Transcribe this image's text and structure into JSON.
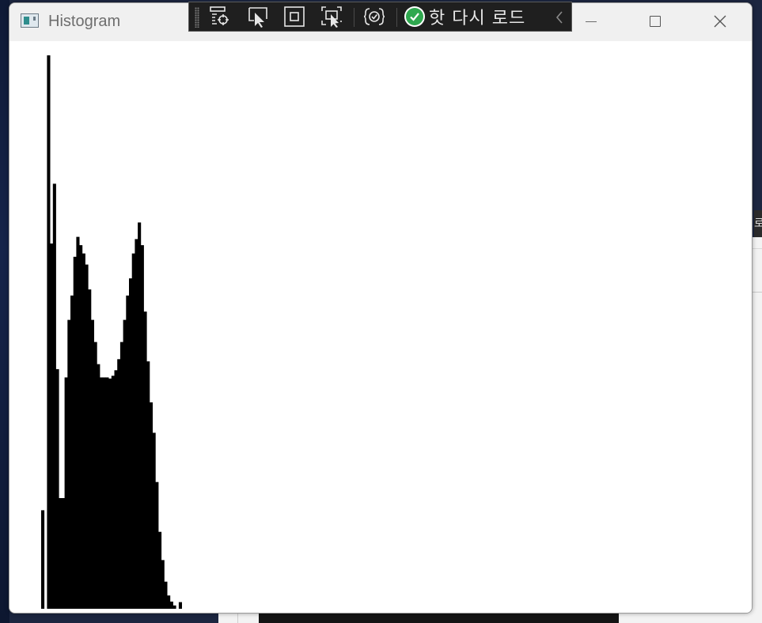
{
  "window": {
    "title": "Histogram",
    "controls": {
      "minimize": "minimize",
      "maximize": "maximize",
      "close": "close"
    }
  },
  "debug_toolbar": {
    "buttons": [
      {
        "icon": "live-visual-tree-icon"
      },
      {
        "icon": "select-element-icon"
      },
      {
        "icon": "display-layout-adorners-icon"
      },
      {
        "icon": "track-focused-element-icon"
      },
      {
        "icon": "xaml-binding-failures-icon"
      }
    ],
    "hot_reload_label": "핫 다시 로드",
    "hot_reload_status_color": "#2fa84f"
  },
  "background_tab_glyph": "로",
  "chart_data": {
    "type": "bar",
    "description_levels": "pixel intensity 0-255",
    "y_scale": "normalized to max bin",
    "color": "#000000",
    "values": [
      0,
      0,
      0,
      0,
      0,
      0,
      0,
      0,
      0,
      0,
      0,
      0,
      0,
      0,
      0,
      0,
      0,
      0,
      0,
      0,
      0,
      0,
      0,
      0,
      0,
      0,
      0,
      0,
      0,
      0,
      0,
      0,
      0,
      0,
      0,
      0,
      0,
      0,
      0,
      0,
      0,
      0,
      0,
      0,
      0,
      0,
      0,
      0,
      0,
      0,
      0,
      0,
      0,
      0,
      0,
      0,
      0,
      0,
      0,
      0,
      0,
      0,
      0,
      0,
      0,
      0,
      0,
      0,
      0,
      0,
      0,
      0,
      0,
      0,
      0,
      0,
      0,
      0,
      0,
      0,
      0,
      0,
      0,
      0,
      0,
      0,
      0,
      0,
      0,
      0,
      0,
      0,
      0,
      0,
      0,
      0,
      0,
      0,
      0,
      0,
      0,
      0,
      0,
      0,
      0,
      0,
      0,
      0,
      0,
      0,
      0,
      0,
      0,
      0,
      0,
      0,
      0,
      0,
      0,
      0,
      0,
      0,
      0,
      0,
      0,
      0,
      0,
      0,
      0,
      0,
      0,
      0,
      0,
      0,
      0,
      0,
      0,
      0,
      0,
      0,
      0,
      0,
      0,
      0,
      0,
      0,
      0,
      0,
      0,
      0,
      0,
      0,
      0,
      0,
      0,
      0,
      0,
      0,
      0,
      0,
      0,
      0,
      0,
      0,
      0,
      0,
      0,
      0,
      0,
      0,
      0,
      0,
      0,
      0,
      0,
      0,
      0,
      0,
      0,
      0,
      0,
      0,
      0,
      0,
      0,
      0,
      0,
      0,
      0,
      0,
      0,
      0,
      0,
      0,
      0,
      0,
      0,
      0,
      0,
      0,
      0,
      0,
      0,
      0,
      0,
      0,
      0,
      0,
      0,
      0,
      0,
      0,
      0,
      0,
      0,
      0,
      0,
      0,
      0,
      0,
      0,
      0,
      0,
      0,
      0,
      0,
      0,
      0,
      0,
      0,
      0,
      0,
      0,
      0,
      0,
      0,
      0,
      0,
      0,
      0,
      0,
      0,
      0,
      0,
      0,
      0,
      0,
      0,
      0,
      0,
      0,
      0,
      0,
      0,
      0,
      0,
      0,
      0,
      0,
      0,
      0
    ],
    "bins": [
      {
        "x": 0,
        "y": 0.178
      },
      {
        "x": 1,
        "y": 0
      },
      {
        "x": 2,
        "y": 1.0
      },
      {
        "x": 3,
        "y": 0.66
      },
      {
        "x": 4,
        "y": 0.768
      },
      {
        "x": 5,
        "y": 0.433
      },
      {
        "x": 6,
        "y": 0.2
      },
      {
        "x": 7,
        "y": 0.2
      },
      {
        "x": 8,
        "y": 0.418
      },
      {
        "x": 9,
        "y": 0.522
      },
      {
        "x": 10,
        "y": 0.566
      },
      {
        "x": 11,
        "y": 0.636
      },
      {
        "x": 12,
        "y": 0.672
      },
      {
        "x": 13,
        "y": 0.657
      },
      {
        "x": 14,
        "y": 0.642
      },
      {
        "x": 15,
        "y": 0.622
      },
      {
        "x": 16,
        "y": 0.577
      },
      {
        "x": 17,
        "y": 0.522
      },
      {
        "x": 18,
        "y": 0.482
      },
      {
        "x": 19,
        "y": 0.442
      },
      {
        "x": 20,
        "y": 0.418
      },
      {
        "x": 21,
        "y": 0.418
      },
      {
        "x": 22,
        "y": 0.418
      },
      {
        "x": 23,
        "y": 0.416
      },
      {
        "x": 24,
        "y": 0.421
      },
      {
        "x": 25,
        "y": 0.431
      },
      {
        "x": 26,
        "y": 0.451
      },
      {
        "x": 27,
        "y": 0.482
      },
      {
        "x": 28,
        "y": 0.522
      },
      {
        "x": 29,
        "y": 0.566
      },
      {
        "x": 30,
        "y": 0.597
      },
      {
        "x": 31,
        "y": 0.642
      },
      {
        "x": 32,
        "y": 0.668
      },
      {
        "x": 33,
        "y": 0.698
      },
      {
        "x": 34,
        "y": 0.657
      },
      {
        "x": 35,
        "y": 0.537
      },
      {
        "x": 36,
        "y": 0.447
      },
      {
        "x": 37,
        "y": 0.373
      },
      {
        "x": 38,
        "y": 0.318
      },
      {
        "x": 39,
        "y": 0.229
      },
      {
        "x": 40,
        "y": 0.139
      },
      {
        "x": 41,
        "y": 0.088
      },
      {
        "x": 42,
        "y": 0.049
      },
      {
        "x": 43,
        "y": 0.024
      },
      {
        "x": 44,
        "y": 0.013
      },
      {
        "x": 45,
        "y": 0.006
      },
      {
        "x": 46,
        "y": 0
      },
      {
        "x": 47,
        "y": 0.012
      }
    ]
  }
}
